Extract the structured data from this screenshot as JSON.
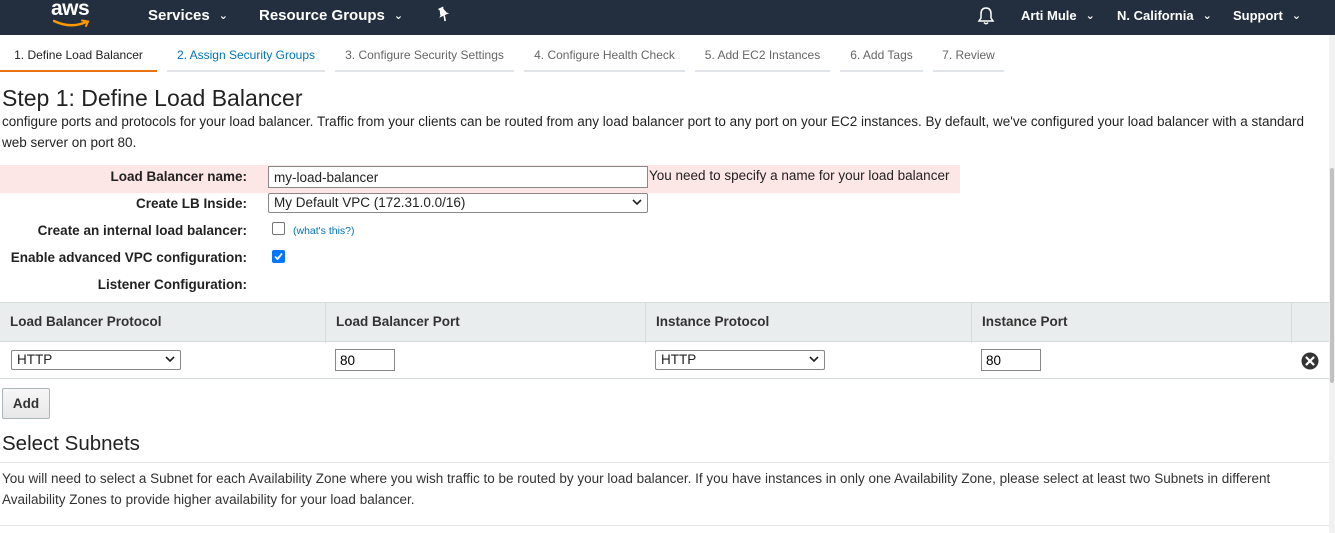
{
  "topnav": {
    "logo_text": "aws",
    "services": "Services",
    "resource_groups": "Resource Groups",
    "user": "Arti Mule",
    "region": "N. California",
    "support": "Support",
    "bg_color": "#232f3e",
    "accent_color": "#ec7211"
  },
  "wizard": {
    "tabs": [
      {
        "label": "1. Define Load Balancer",
        "state": "active"
      },
      {
        "label": "2. Assign Security Groups",
        "state": "link"
      },
      {
        "label": "3. Configure Security Settings",
        "state": "inactive"
      },
      {
        "label": "4. Configure Health Check",
        "state": "inactive"
      },
      {
        "label": "5. Add EC2 Instances",
        "state": "inactive"
      },
      {
        "label": "6. Add Tags",
        "state": "inactive"
      },
      {
        "label": "7. Review",
        "state": "inactive"
      }
    ]
  },
  "page": {
    "title": "Step 1: Define Load Balancer",
    "description": "configure ports and protocols for your load balancer. Traffic from your clients can be routed from any load balancer port to any port on your EC2 instances. By default, we've configured your load balancer with a standard web server on port 80."
  },
  "form": {
    "name_label": "Load Balancer name:",
    "name_value": "my-load-balancer",
    "name_error": "You need to specify a name for your load balancer",
    "vpc_label": "Create LB Inside:",
    "vpc_value": "My Default VPC (172.31.0.0/16)",
    "internal_label": "Create an internal load balancer:",
    "internal_checked": false,
    "whats_this": "(what's this?)",
    "advanced_label": "Enable advanced VPC configuration:",
    "advanced_checked": true,
    "listener_label": "Listener Configuration:"
  },
  "listeners": {
    "headers": [
      "Load Balancer Protocol",
      "Load Balancer Port",
      "Instance Protocol",
      "Instance Port"
    ],
    "rows": [
      {
        "lb_protocol": "HTTP",
        "lb_port": "80",
        "instance_protocol": "HTTP",
        "instance_port": "80"
      }
    ],
    "add_label": "Add"
  },
  "subnets": {
    "title": "Select Subnets",
    "description": "You will need to select a Subnet for each Availability Zone where you wish traffic to be routed by your load balancer. If you have instances in only one Availability Zone, please select at least two Subnets in different Availability Zones to provide higher availability for your load balancer."
  }
}
